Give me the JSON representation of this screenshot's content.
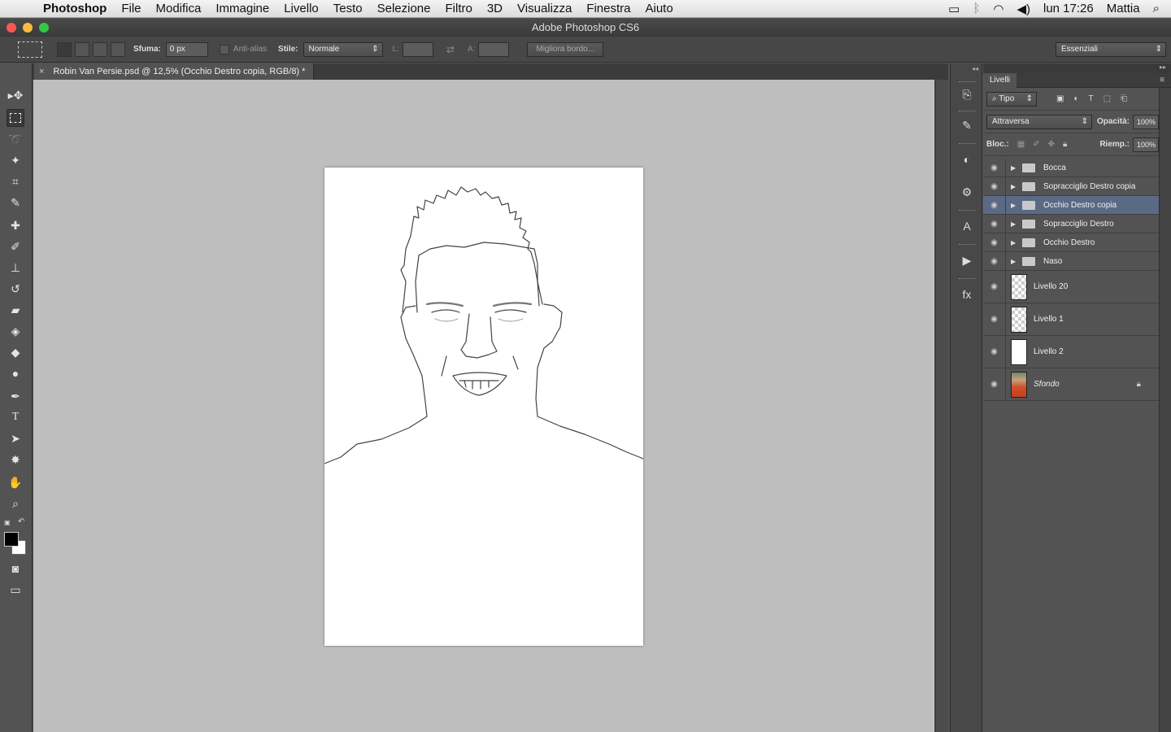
{
  "menubar": {
    "app": "Photoshop",
    "items": [
      "File",
      "Modifica",
      "Immagine",
      "Livello",
      "Testo",
      "Selezione",
      "Filtro",
      "3D",
      "Visualizza",
      "Finestra",
      "Aiuto"
    ],
    "clock": "lun 17:26",
    "user": "Mattia"
  },
  "window": {
    "title": "Adobe Photoshop CS6"
  },
  "options": {
    "feather_label": "Sfuma:",
    "feather_value": "0 px",
    "antialias_label": "Anti-alias",
    "style_label": "Stile:",
    "style_value": "Normale",
    "width_label": "L:",
    "height_label": "A:",
    "refine_label": "Migliora bordo...",
    "workspace": "Essenziali"
  },
  "document": {
    "tab_title": "Robin Van Persie.psd @ 12,5% (Occhio Destro copia, RGB/8) *"
  },
  "layers_panel": {
    "tab": "Livelli",
    "filter": "Tipo",
    "blend": "Attraversa",
    "opacity_label": "Opacità:",
    "opacity_value": "100%",
    "lock_label": "Bloc.:",
    "fill_label": "Riemp.:",
    "fill_value": "100%",
    "groups": [
      "Bocca",
      "Sopracciglio Destro copia",
      "Occhio Destro copia",
      "Sopracciglio Destro",
      "Occhio Destro",
      "Naso"
    ],
    "selected_group": "Occhio Destro copia",
    "layers": [
      {
        "name": "Livello 20",
        "thumb": "checker"
      },
      {
        "name": "Livello 1",
        "thumb": "checker"
      },
      {
        "name": "Livello 2",
        "thumb": "white"
      },
      {
        "name": "Sfondo",
        "thumb": "photo",
        "locked": true
      }
    ]
  },
  "colors": {
    "foreground": "#000000",
    "background": "#ffffff",
    "selection": "#5a6a85"
  }
}
